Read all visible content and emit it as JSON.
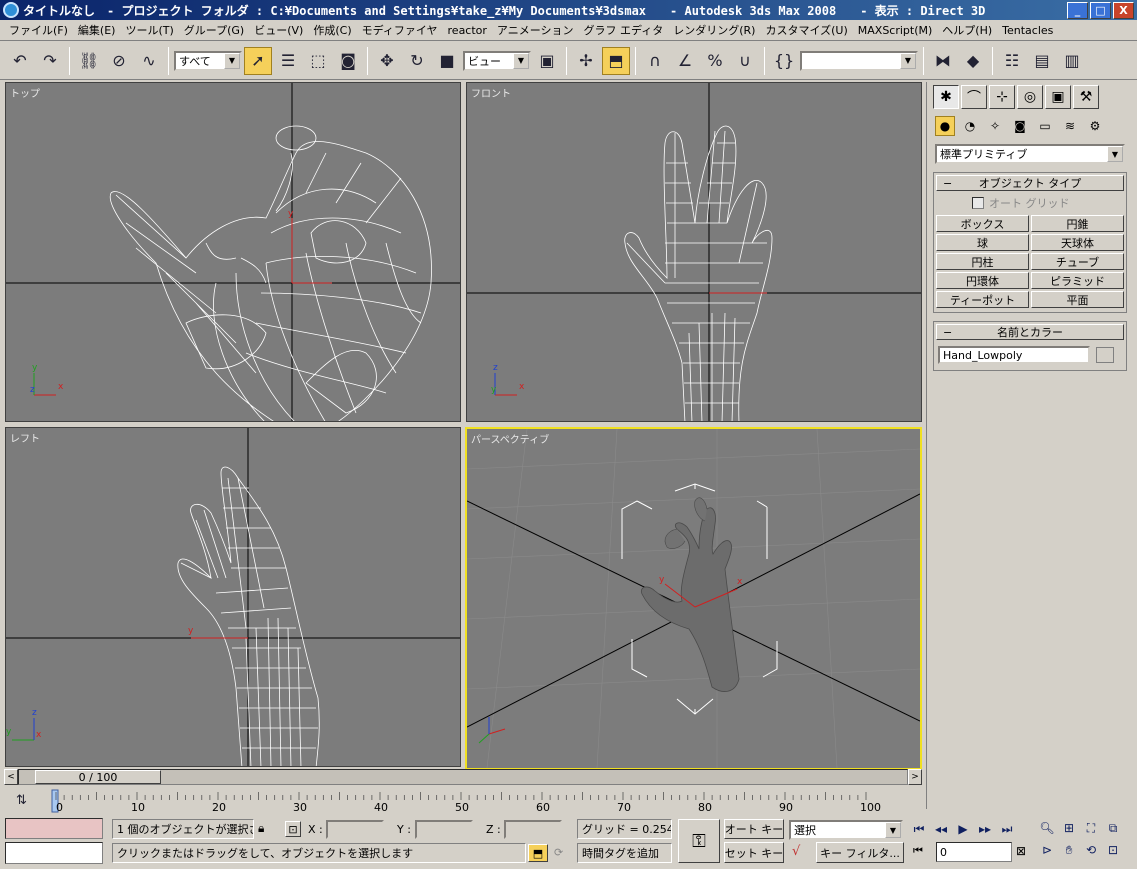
{
  "window": {
    "title": "タイトルなし　- プロジェクト フォルダ : C:¥Documents and Settings¥take_z¥My Documents¥3dsmax　　- Autodesk 3ds Max 2008　　- 表示 : Direct 3D",
    "minimize": "_",
    "maximize": "□",
    "close": "X"
  },
  "menu": [
    "ファイル(F)",
    "編集(E)",
    "ツール(T)",
    "グループ(G)",
    "ビュー(V)",
    "作成(C)",
    "モディファイヤ",
    "reactor",
    "アニメーション",
    "グラフ エディタ",
    "レンダリング(R)",
    "カスタマイズ(U)",
    "MAXScript(M)",
    "ヘルプ(H)",
    "Tentacles"
  ],
  "toolbar": {
    "selection_filter": "すべて",
    "reference_coord": "ビュー",
    "named_selection": ""
  },
  "viewports": {
    "top": "トップ",
    "front": "フロント",
    "left": "レフト",
    "perspective": "パースペクティブ"
  },
  "axes": {
    "x": "x",
    "y": "y",
    "z": "z"
  },
  "command_panel": {
    "category": "標準プリミティブ",
    "object_type_title": "オブジェクト タイプ",
    "autogrid": "オート グリッド",
    "primitives": [
      "ボックス",
      "円錐",
      "球",
      "天球体",
      "円柱",
      "チューブ",
      "円環体",
      "ピラミッド",
      "ティーポット",
      "平面"
    ],
    "name_color_title": "名前とカラー",
    "object_name": "Hand_Lowpoly",
    "collapse_symbol": "−"
  },
  "time_slider": {
    "position": "0 / 100",
    "current_frame": 0,
    "total_frames": 100
  },
  "track_bar": {
    "ticks": [
      "0",
      "10",
      "20",
      "30",
      "40",
      "50",
      "60",
      "70",
      "80",
      "90",
      "100"
    ]
  },
  "status": {
    "selection_info": "1 個のオブジェクトが選択され",
    "prompt": "クリックまたはドラッグをして、オブジェクトを選択します",
    "x_label": "X :",
    "y_label": "Y :",
    "z_label": "Z :",
    "grid": "グリッド = 0.254m",
    "add_time_tag": "時間タグを追加",
    "auto_key": "オート キー",
    "set_key": "セット キー",
    "key_mode": "選択",
    "key_filter": "キー フィルタ...",
    "frame_value": "0"
  },
  "colors": {
    "viewport_bg": "#7c7c7c",
    "active_border": "#f0e020",
    "wire": "#ffffff",
    "title_gradient_start": "#0a246a"
  }
}
